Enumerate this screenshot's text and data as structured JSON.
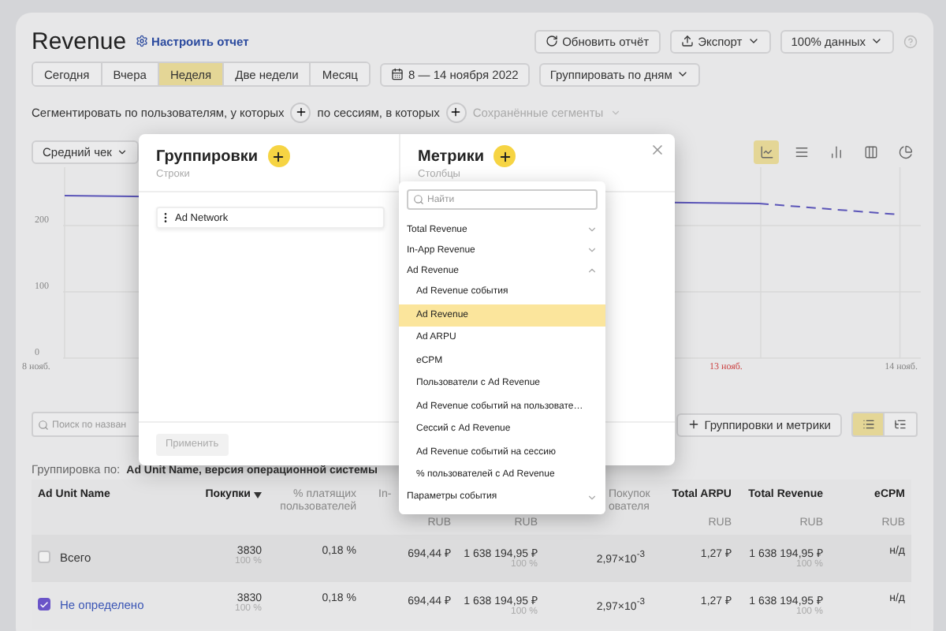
{
  "header": {
    "title": "Revenue",
    "settings_link": "Настроить отчет",
    "buttons": [
      {
        "kind": "refresh",
        "label": "Обновить отчёт"
      },
      {
        "kind": "export",
        "label": "Экспорт"
      },
      {
        "kind": "dropdown",
        "label": "100% данных"
      }
    ]
  },
  "periods": [
    {
      "label": "Сегодня",
      "selected": false
    },
    {
      "label": "Вчера",
      "selected": false
    },
    {
      "label": "Неделя",
      "selected": true
    },
    {
      "label": "Две недели",
      "selected": false
    },
    {
      "label": "Месяц",
      "selected": false
    }
  ],
  "date_range": "8 — 14 ноября 2022",
  "grouping_select": "Группировать по дням",
  "segments": {
    "users_label": "Сегментировать по пользователям, у которых",
    "sessions_label": "по сессиям, в которых",
    "saved": "Сохранённые сегменты"
  },
  "chart": {
    "metric_select": "Средний чек",
    "types": [
      {
        "kind": "line",
        "selected": true
      },
      {
        "kind": "stacked",
        "selected": false
      },
      {
        "kind": "bars",
        "selected": false
      },
      {
        "kind": "columns",
        "selected": false
      },
      {
        "kind": "pie",
        "selected": false
      }
    ],
    "y_ticks": [
      "200",
      "100",
      "0"
    ],
    "x_labels": [
      {
        "text": "8 нояб.",
        "weekend": false
      },
      {
        "text": "13 нояб.",
        "weekend": true
      },
      {
        "text": "14 нояб.",
        "weekend": false
      }
    ]
  },
  "toolbar": {
    "search_placeholder": "Поиск по назван",
    "add_button": "Группировки и метрики",
    "views": [
      {
        "kind": "list",
        "selected": true
      },
      {
        "kind": "tree",
        "selected": false
      }
    ]
  },
  "grouping": {
    "label": "Группировка по:",
    "value": "Ad Unit Name, версия операционной системы"
  },
  "table": {
    "columns": [
      {
        "title": "Ad Unit Name"
      },
      {
        "title": "Покупки",
        "sorted": true
      },
      {
        "title": "% платящих пользователей"
      },
      {
        "title": "In-",
        "unit": "RUB"
      },
      {
        "unit": "RUB"
      },
      {
        "title": "Покупок ователя"
      },
      {
        "title": "Total ARPU",
        "unit": "RUB"
      },
      {
        "title": "Total Revenue",
        "unit": "RUB"
      },
      {
        "title": "eCPM",
        "unit": "RUB"
      }
    ],
    "rows": [
      {
        "kind": "total",
        "checked": false,
        "cells": [
          {
            "value": "Всего"
          },
          {
            "value": "3830",
            "share": "100 %"
          },
          {
            "value": "0,18 %"
          },
          {
            "value": "694,44 ₽"
          },
          {
            "value": "1 638 194,95 ₽",
            "share": "100 %"
          },
          {
            "value": "2,97×10$^{-3}$"
          },
          {
            "value": "1,27 ₽"
          },
          {
            "value": "1 638 194,95 ₽",
            "share": "100 %"
          },
          {
            "value": "н/д"
          }
        ]
      },
      {
        "kind": "item",
        "checked": true,
        "cells": [
          {
            "value": "Не определено"
          },
          {
            "value": "3830",
            "share": "100 %"
          },
          {
            "value": "0,18 %"
          },
          {
            "value": "694,44 ₽"
          },
          {
            "value": "1 638 194,95 ₽",
            "share": "100 %"
          },
          {
            "value": "2,97×10$^{-3}$"
          },
          {
            "value": "1,27 ₽"
          },
          {
            "value": "1 638 194,95 ₽",
            "share": "100 %"
          },
          {
            "value": "н/д"
          }
        ]
      }
    ]
  },
  "modal": {
    "groupings": {
      "title": "Группировки",
      "subtitle": "Строки",
      "items": [
        "Ad Network"
      ]
    },
    "metrics": {
      "title": "Метрики",
      "subtitle": "Столбцы"
    },
    "apply_button": {
      "label": "Применить",
      "disabled": true
    }
  },
  "metrics_dropdown": {
    "search_placeholder": "Найти",
    "groups": [
      {
        "label": "Total Revenue",
        "expanded": false
      },
      {
        "label": "In-App Revenue",
        "expanded": false
      },
      {
        "label": "Ad Revenue",
        "expanded": true,
        "children": [
          {
            "label": "Ad Revenue события",
            "selected": false
          },
          {
            "label": "Ad Revenue",
            "selected": true
          },
          {
            "label": "Ad ARPU",
            "selected": false
          },
          {
            "label": "eCPM",
            "selected": false
          },
          {
            "label": "Пользователи с Ad Revenue",
            "selected": false
          },
          {
            "label": "Ad Revenue событий на пользовате…",
            "selected": false
          },
          {
            "label": "Сессий с Ad Revenue",
            "selected": false
          },
          {
            "label": "Ad Revenue событий на сессию",
            "selected": false
          },
          {
            "label": "% пользователей с Ad Revenue",
            "selected": false
          }
        ]
      },
      {
        "label": "Параметры события",
        "expanded": false
      }
    ]
  }
}
